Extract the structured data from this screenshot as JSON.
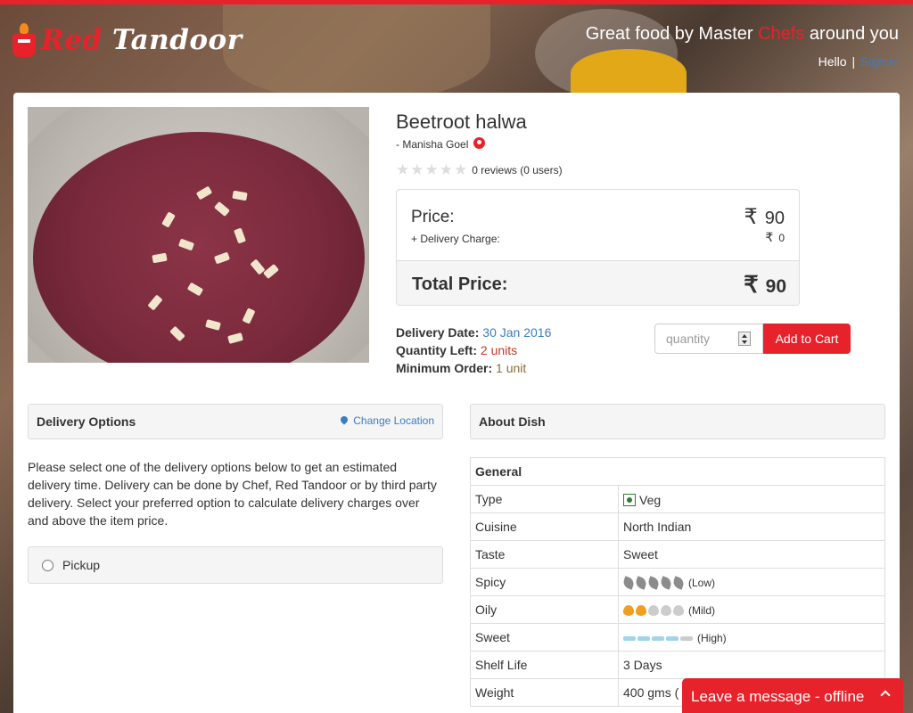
{
  "header": {
    "logo_red": "Red",
    "logo_white": "Tandoor",
    "tagline_pre": "Great food by Master ",
    "tagline_chef": "Chefs",
    "tagline_post": " around you",
    "hello": "Hello",
    "separator": "|",
    "signin": "Sign in"
  },
  "dish": {
    "title": "Beetroot halwa",
    "chef": "- Manisha Goel",
    "stars": "★★★★★",
    "reviews": "0 reviews (0 users)",
    "currency_symbol": "₹",
    "price_label": "Price:",
    "price": "90",
    "delivery_label": "+ Delivery Charge:",
    "delivery_charge": "0",
    "total_label": "Total Price:",
    "total": "90",
    "delivery_date_label": "Delivery Date:",
    "delivery_date": "30 Jan 2016",
    "quantity_left_label": "Quantity Left:",
    "quantity_left": "2 units",
    "min_order_label": "Minimum Order:",
    "min_order": "1 unit",
    "quantity_placeholder": "quantity",
    "add_to_cart": "Add to Cart"
  },
  "delivery": {
    "heading": "Delivery Options",
    "change_location": "Change Location",
    "description": "Please select one of the delivery options below to get an estimated delivery time. Delivery can be done by Chef, Red Tandoor or by third party delivery. Select your preferred option to calculate delivery charges over and above the item price.",
    "option_pickup": "Pickup"
  },
  "about": {
    "heading": "About Dish",
    "general": "General",
    "rows": [
      {
        "key": "Type",
        "value": "Veg"
      },
      {
        "key": "Cuisine",
        "value": "North Indian"
      },
      {
        "key": "Taste",
        "value": "Sweet"
      },
      {
        "key": "Spicy",
        "value": "(Low)"
      },
      {
        "key": "Oily",
        "value": "(Mild)"
      },
      {
        "key": "Sweet",
        "value": "(High)"
      },
      {
        "key": "Shelf Life",
        "value": "3 Days"
      },
      {
        "key": "Weight",
        "value": "400 gms ("
      }
    ],
    "spicy_level": 0.2,
    "oily_level": 0.4,
    "sweet_level": 0.8
  },
  "chat": {
    "label": "Leave a message - offline"
  },
  "colors": {
    "brand_red": "#e8222a",
    "link_blue": "#3b7dc1"
  }
}
